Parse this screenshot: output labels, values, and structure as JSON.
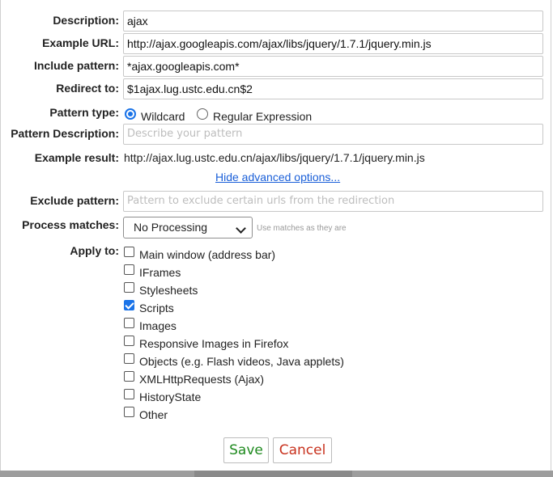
{
  "form": {
    "description": {
      "label": "Description:",
      "value": "ajax"
    },
    "example_url": {
      "label": "Example URL:",
      "value": "http://ajax.googleapis.com/ajax/libs/jquery/1.7.1/jquery.min.js"
    },
    "include_pattern": {
      "label": "Include pattern:",
      "value": "*ajax.googleapis.com*"
    },
    "redirect_to": {
      "label": "Redirect to:",
      "value": "$1ajax.lug.ustc.edu.cn$2"
    },
    "pattern_type": {
      "label": "Pattern type:",
      "options": [
        "Wildcard",
        "Regular Expression"
      ],
      "selected": "Wildcard"
    },
    "pattern_description": {
      "label": "Pattern Description:",
      "placeholder": "Describe your pattern"
    },
    "example_result": {
      "label": "Example result:",
      "value": "http://ajax.lug.ustc.edu.cn/ajax/libs/jquery/1.7.1/jquery.min.js"
    },
    "advanced_link": "Hide advanced options...",
    "exclude_pattern": {
      "label": "Exclude pattern:",
      "placeholder": "Pattern to exclude certain urls from the redirection"
    },
    "process_matches": {
      "label": "Process matches:",
      "selected": "No Processing",
      "hint": "Use matches as they are"
    },
    "apply_to": {
      "label": "Apply to:",
      "items": [
        {
          "label": "Main window (address bar)",
          "checked": false
        },
        {
          "label": "IFrames",
          "checked": false
        },
        {
          "label": "Stylesheets",
          "checked": false
        },
        {
          "label": "Scripts",
          "checked": true
        },
        {
          "label": "Images",
          "checked": false
        },
        {
          "label": "Responsive Images in Firefox",
          "checked": false
        },
        {
          "label": "Objects (e.g. Flash videos, Java applets)",
          "checked": false
        },
        {
          "label": "XMLHttpRequests (Ajax)",
          "checked": false
        },
        {
          "label": "HistoryState",
          "checked": false
        },
        {
          "label": "Other",
          "checked": false
        }
      ]
    }
  },
  "buttons": {
    "save": "Save",
    "cancel": "Cancel"
  },
  "colors": {
    "accent": "#1a73e8",
    "save": "#1f8a1f",
    "cancel": "#c8321e",
    "link": "#1a5fd8"
  }
}
